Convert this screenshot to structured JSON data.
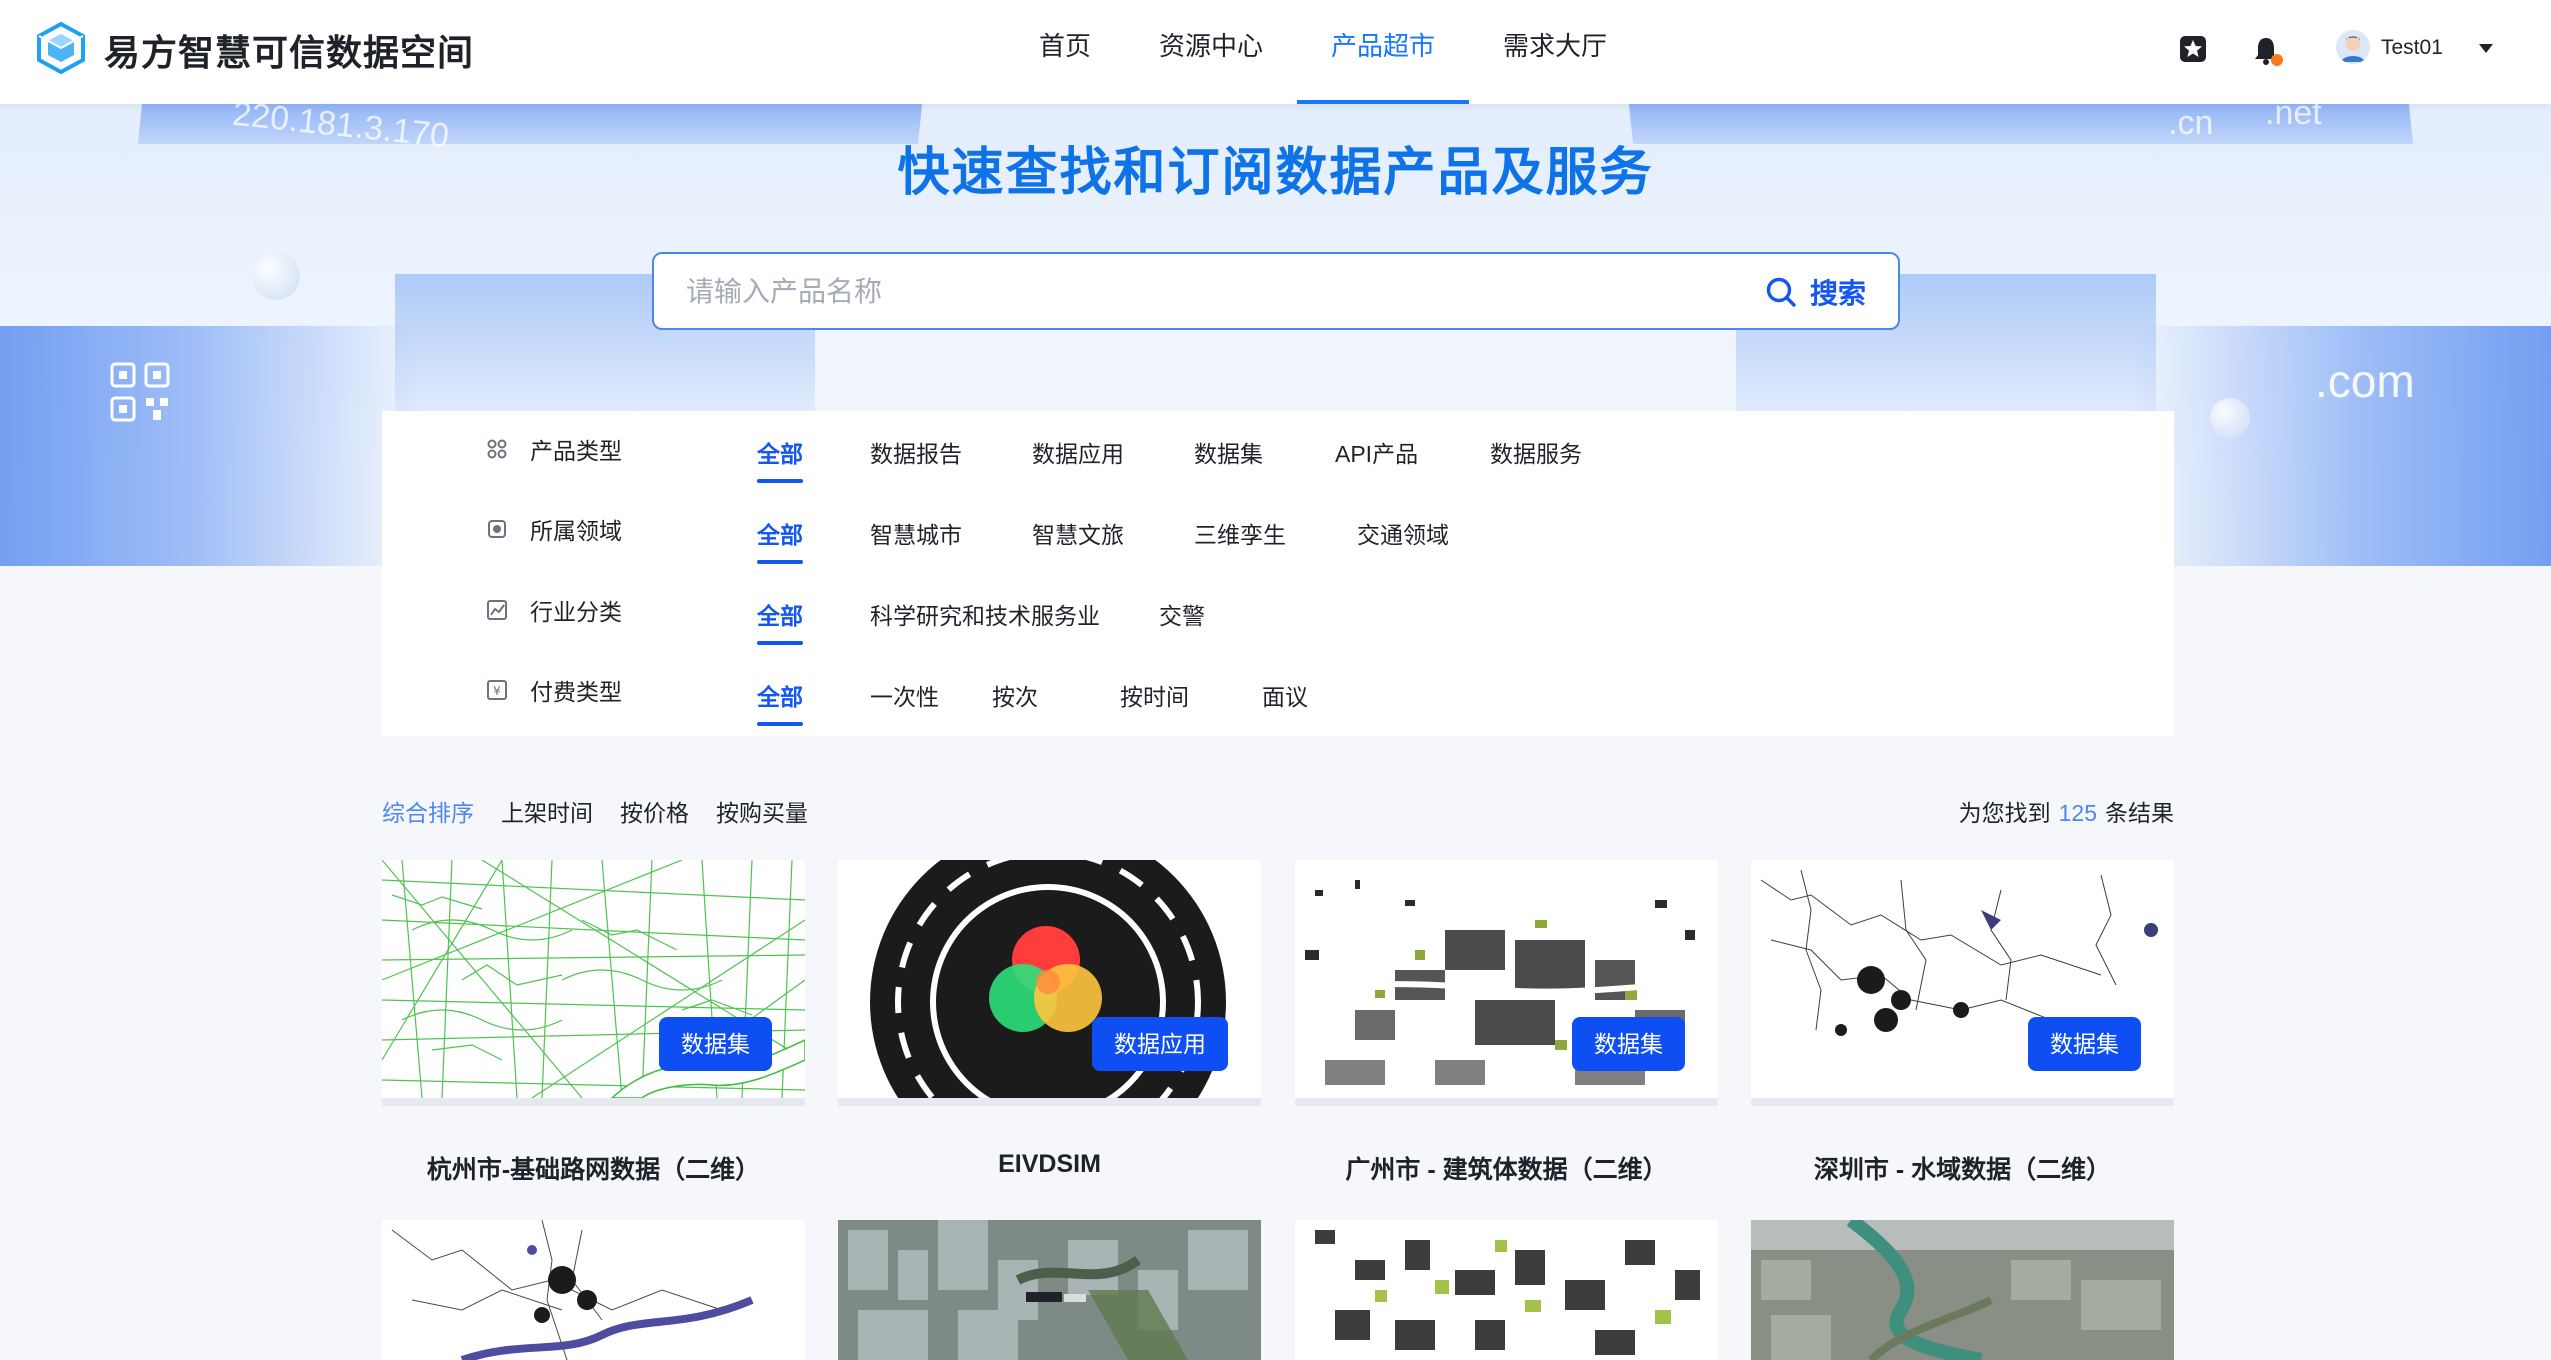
{
  "header": {
    "brand": "易方智慧可信数据空间",
    "nav": [
      "首页",
      "资源中心",
      "产品超市",
      "需求大厅"
    ],
    "active_nav": "产品超市",
    "username": "Test01",
    "colors": {
      "accent": "#1677ff",
      "badge": "#0d4ff2",
      "notify_dot": "#f77a1b"
    }
  },
  "hero": {
    "title": "快速查找和订阅数据产品及服务",
    "search_placeholder": "请输入产品名称",
    "search_button": "搜索",
    "decor": {
      "ip": "220.181.3.170",
      "cn": ".cn",
      "net": ".net",
      "com": ".com"
    }
  },
  "filters": [
    {
      "label": "产品类型",
      "icon": "grid-icon",
      "options": [
        "全部",
        "数据报告",
        "数据应用",
        "数据集",
        "API产品",
        "数据服务"
      ],
      "selected": "全部"
    },
    {
      "label": "所属领域",
      "icon": "domain-icon",
      "options": [
        "全部",
        "智慧城市",
        "智慧文旅",
        "三维孪生",
        "交通领域"
      ],
      "selected": "全部"
    },
    {
      "label": "行业分类",
      "icon": "chart-icon",
      "options": [
        "全部",
        "科学研究和技术服务业",
        "交警"
      ],
      "selected": "全部"
    },
    {
      "label": "付费类型",
      "icon": "yen-icon",
      "options": [
        "全部",
        "一次性",
        "按次",
        "按时间",
        "面议"
      ],
      "selected": "全部"
    }
  ],
  "sort": {
    "options": [
      "综合排序",
      "上架时间",
      "按价格",
      "按购买量"
    ],
    "selected": "综合排序",
    "result_prefix": "为您找到",
    "result_count": "125",
    "result_suffix": "条结果"
  },
  "products": [
    {
      "title": "杭州市-基础路网数据（二维）",
      "badge": "数据集",
      "thumb": "green-road-map"
    },
    {
      "title": "EIVDSIM",
      "badge": "数据应用",
      "thumb": "road-circle-logo"
    },
    {
      "title": "广州市 - 建筑体数据（二维）",
      "badge": "数据集",
      "thumb": "building-map"
    },
    {
      "title": "深圳市 - 水域数据（二维）",
      "badge": "数据集",
      "thumb": "water-map"
    }
  ],
  "products_row2": [
    {
      "thumb": "city-map-outline"
    },
    {
      "thumb": "aerial-city-3d"
    },
    {
      "thumb": "building-map-color"
    },
    {
      "thumb": "aerial-river-3d"
    }
  ]
}
